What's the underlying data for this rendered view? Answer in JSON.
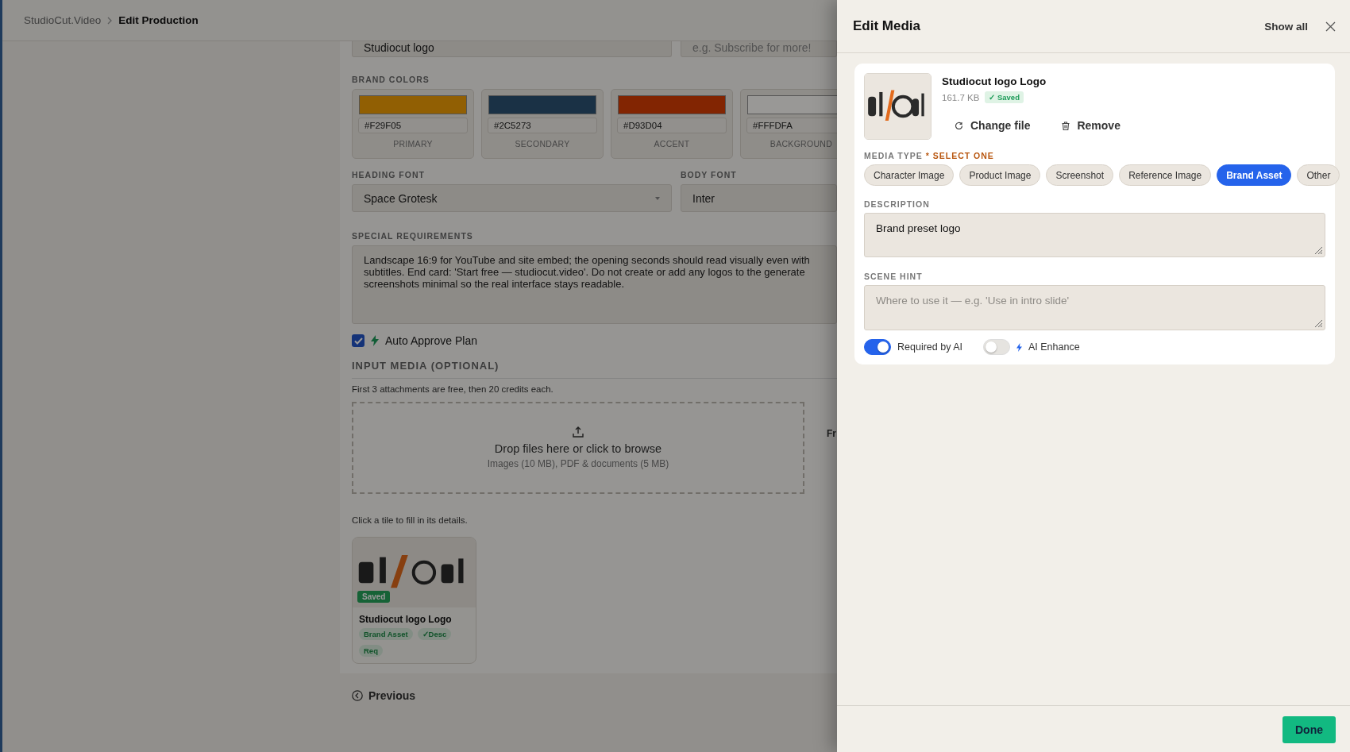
{
  "breadcrumb": [
    {
      "label": "StudioCut.Video",
      "current": false
    },
    {
      "label": "Edit Production",
      "current": true
    }
  ],
  "form": {
    "top_fields": [
      {
        "value": "Studiocut logo"
      },
      {
        "placeholder": "e.g. Subscribe for more!"
      }
    ],
    "brand_colors": {
      "label": "BRAND COLORS",
      "swatches": [
        {
          "color": "#915f03",
          "hex": "#F29F05",
          "role": "PRIMARY"
        },
        {
          "color": "#1a3145",
          "hex": "#2C5273",
          "role": "SECONDARY"
        },
        {
          "color": "#822502",
          "hex": "#D93D04",
          "role": "ACCENT"
        },
        {
          "color": "#999896",
          "hex": "#FFFDFA",
          "role": "BACKGROUND"
        }
      ]
    },
    "heading_font": {
      "label": "HEADING FONT",
      "value": "Space Grotesk"
    },
    "body_font": {
      "label": "BODY FONT",
      "value": "Inter"
    },
    "special_requirements": {
      "label": "SPECIAL REQUIREMENTS",
      "lines": [
        "Landscape 16:9 for YouTube and site embed; the opening seconds should read visually even with",
        "subtitles. End card: 'Start free — studiocut.video'. Do not create or add any logos to the generate",
        "screenshots minimal so the real interface stays readable."
      ]
    },
    "auto_approve": {
      "label": "Auto Approve Plan",
      "checked": true
    },
    "input_media": {
      "title": "INPUT MEDIA (OPTIONAL)",
      "note": "First 3 attachments are free, then 20 credits each.",
      "dropzone": {
        "title": "Drop files here or click to browse",
        "subtitle": "Images (10 MB), PDF & documents (5 MB)"
      },
      "side_text": "Fr",
      "hint": "Click a tile to fill in its details.",
      "tiles": [
        {
          "name": "Studiocut logo Logo",
          "status": "Saved",
          "tags": [
            "Brand Asset",
            "✓Desc",
            "Req"
          ]
        }
      ]
    },
    "previous": "Previous"
  },
  "drawer": {
    "title": "Edit Media",
    "show_all": "Show all",
    "media": {
      "name": "Studiocut logo Logo",
      "size": "161.7 KB",
      "status": "✓ Saved"
    },
    "actions": [
      {
        "kind": "change",
        "label": "Change file"
      },
      {
        "kind": "remove",
        "label": "Remove"
      }
    ],
    "media_type": {
      "label": "MEDIA TYPE",
      "required": "* SELECT ONE",
      "options": [
        {
          "label": "Character Image",
          "selected": false
        },
        {
          "label": "Product Image",
          "selected": false
        },
        {
          "label": "Screenshot",
          "selected": false
        },
        {
          "label": "Reference Image",
          "selected": false
        },
        {
          "label": "Brand Asset",
          "selected": true
        },
        {
          "label": "Other",
          "selected": false
        }
      ]
    },
    "description": {
      "label": "DESCRIPTION",
      "value": "Brand preset logo"
    },
    "scene_hint": {
      "label": "SCENE HINT",
      "placeholder": "Where to use it — e.g. 'Use in intro slide'"
    },
    "toggles": [
      {
        "kind": "plain",
        "label": "Required by AI",
        "on": true
      },
      {
        "kind": "ai",
        "label": "AI Enhance",
        "on": false
      }
    ],
    "done": "Done"
  }
}
